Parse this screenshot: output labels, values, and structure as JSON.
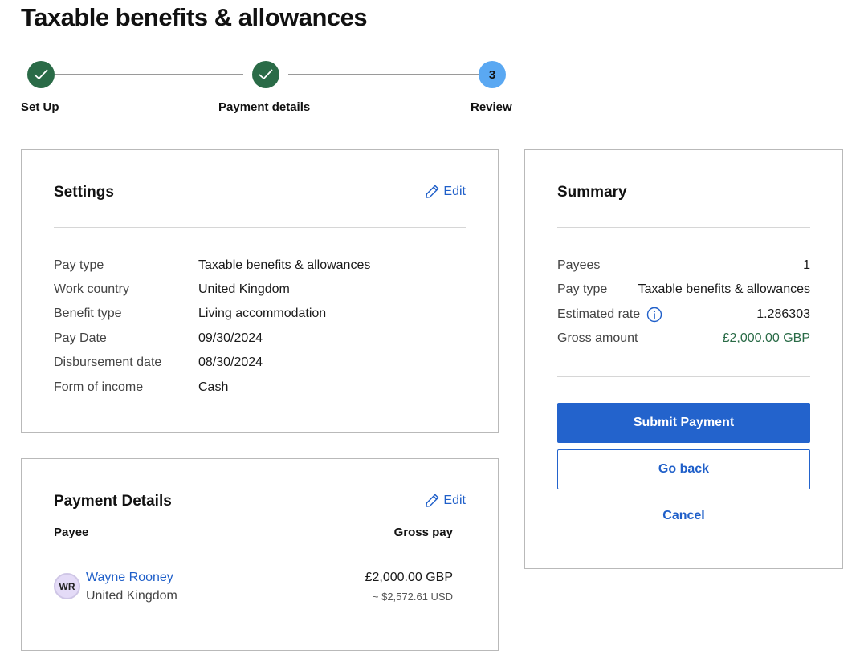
{
  "page": {
    "title": "Taxable benefits & allowances"
  },
  "stepper": {
    "steps": [
      {
        "label": "Set Up",
        "status": "done",
        "icon": "check-icon"
      },
      {
        "label": "Payment details",
        "status": "done",
        "icon": "check-icon"
      },
      {
        "label": "Review",
        "status": "current",
        "number": "3"
      }
    ]
  },
  "settings": {
    "title": "Settings",
    "edit_label": "Edit",
    "rows": [
      {
        "label": "Pay type",
        "value": "Taxable benefits & allowances"
      },
      {
        "label": "Work country",
        "value": "United Kingdom"
      },
      {
        "label": "Benefit type",
        "value": "Living accommodation"
      },
      {
        "label": "Pay Date",
        "value": "09/30/2024"
      },
      {
        "label": "Disbursement date",
        "value": "08/30/2024"
      },
      {
        "label": "Form of income",
        "value": "Cash"
      }
    ]
  },
  "payment_details": {
    "title": "Payment Details",
    "edit_label": "Edit",
    "headers": {
      "payee": "Payee",
      "gross_pay": "Gross pay"
    },
    "payees": [
      {
        "initials": "WR",
        "name": "Wayne  Rooney",
        "country": "United Kingdom",
        "gross": "£2,000.00 GBP",
        "converted": "~ $2,572.61 USD"
      }
    ]
  },
  "summary": {
    "title": "Summary",
    "rows": [
      {
        "label": "Payees",
        "value": "1"
      },
      {
        "label": "Pay type",
        "value": "Taxable benefits & allowances"
      },
      {
        "label": "Estimated rate",
        "value": "1.286303",
        "icon": "info-icon"
      },
      {
        "label": "Gross amount",
        "value": "£2,000.00 GBP"
      }
    ],
    "submit_label": "Submit Payment",
    "back_label": "Go back",
    "cancel_label": "Cancel"
  },
  "colors": {
    "primary": "#2363cc",
    "link": "#1f5fc9",
    "success": "#2a6b47",
    "current_step": "#5aa8f2"
  }
}
